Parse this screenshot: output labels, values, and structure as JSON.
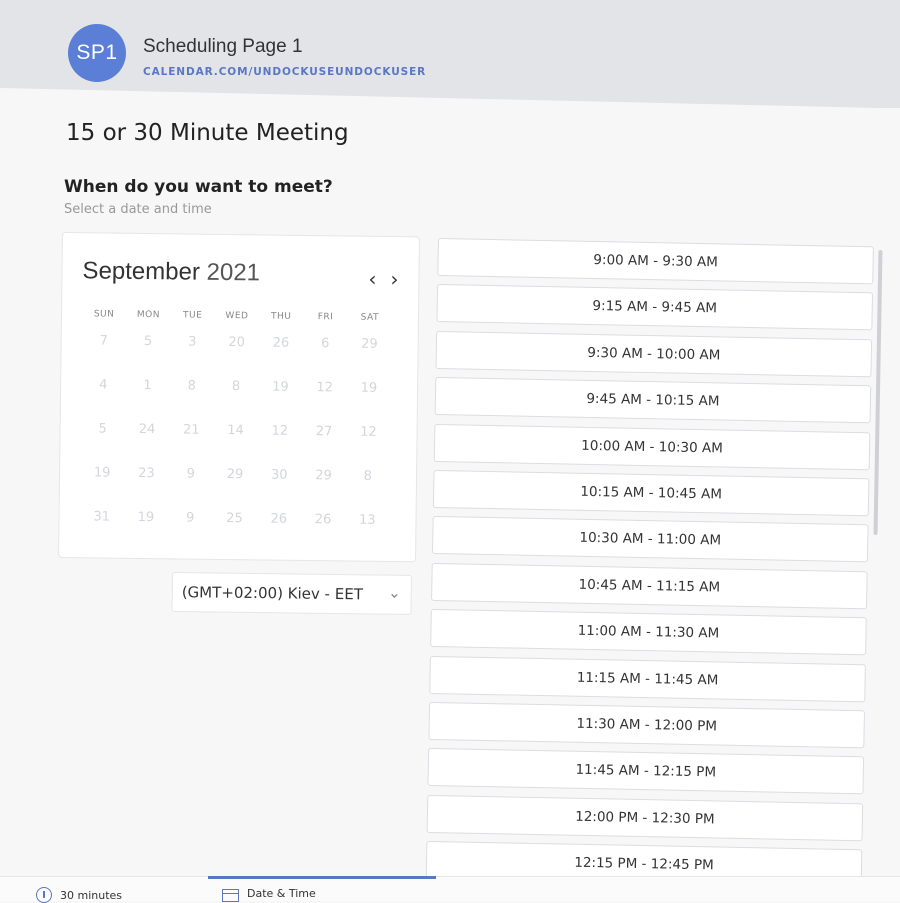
{
  "header": {
    "avatar_initials": "SP1",
    "page_name": "Scheduling Page 1",
    "url": "CALENDAR.COM/UNDOCKUSEUNDOCKUSER"
  },
  "meeting": {
    "title": "15 or 30 Minute Meeting",
    "prompt": "When do you want to meet?",
    "subprompt": "Select a date and time"
  },
  "calendar": {
    "month": "September",
    "year": "2021",
    "weekdays": [
      "SUN",
      "MON",
      "TUE",
      "WED",
      "THU",
      "FRI",
      "SAT"
    ],
    "weeks": [
      [
        "7",
        "5",
        "3",
        "20",
        "26",
        "6",
        "29"
      ],
      [
        "4",
        "1",
        "8",
        "8",
        "19",
        "12",
        "19"
      ],
      [
        "5",
        "24",
        "21",
        "14",
        "12",
        "27",
        "12"
      ],
      [
        "19",
        "23",
        "9",
        "29",
        "30",
        "29",
        "8"
      ],
      [
        "31",
        "19",
        "9",
        "25",
        "26",
        "26",
        "13"
      ]
    ]
  },
  "timezone": {
    "selected": "(GMT+02:00) Kiev - EET"
  },
  "slots": [
    "9:00 AM - 9:30 AM",
    "9:15 AM - 9:45 AM",
    "9:30 AM - 10:00 AM",
    "9:45 AM - 10:15 AM",
    "10:00 AM - 10:30 AM",
    "10:15 AM - 10:45 AM",
    "10:30 AM - 11:00 AM",
    "10:45 AM - 11:15 AM",
    "11:00 AM - 11:30 AM",
    "11:15 AM - 11:45 AM",
    "11:30 AM - 12:00 PM",
    "11:45 AM - 12:15 PM",
    "12:00 PM - 12:30 PM",
    "12:15 PM - 12:45 PM"
  ],
  "footer": {
    "duration_label": "30 minutes",
    "datetime_label": "Date & Time"
  },
  "colors": {
    "accent": "#5a76c4",
    "avatar": "#5b7fd6",
    "header_bg": "#e3e4e8"
  },
  "icons": {
    "prev": "chevron-left-icon",
    "next": "chevron-right-icon",
    "dropdown": "chevron-down-icon",
    "duration": "info-icon",
    "datetime": "calendar-icon"
  }
}
